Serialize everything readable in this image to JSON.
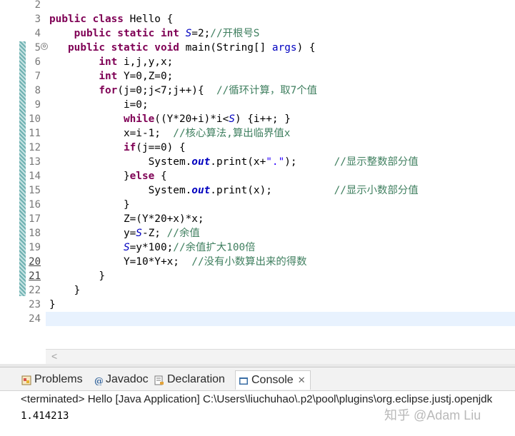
{
  "editor": {
    "line_numbers": [
      "2",
      "3",
      "4",
      "5",
      "6",
      "7",
      "8",
      "9",
      "10",
      "11",
      "12",
      "13",
      "14",
      "15",
      "16",
      "17",
      "18",
      "19",
      "20",
      "21",
      "22",
      "23",
      "24"
    ],
    "fold_symbol": "⊖",
    "code": {
      "l3": {
        "kw1": "public class ",
        "rest": "Hello {"
      },
      "l4": {
        "kw1": "public static int ",
        "sf": "S",
        "rest": "=2;",
        "cm": "//开根号S"
      },
      "l5": {
        "kw1": "public static void ",
        "rest": "main(String[] ",
        "vr": "args",
        ")": ") {"
      },
      "l6": {
        "kw1": "int ",
        "rest": "i,j,y,x;"
      },
      "l7": {
        "kw1": "int ",
        "rest": "Y=0,Z=0;"
      },
      "l8": {
        "kw1": "for",
        "rest": "(j=0;j<7;j++){  ",
        "cm": "//循环计算，取7个值"
      },
      "l9": {
        "rest": "i=0;"
      },
      "l10": {
        "kw1": "while",
        "rest1": "((Y*20+i)*i<",
        "sf": "S",
        "rest2": ") {i++; }"
      },
      "l11": {
        "rest": "x=i-1;  ",
        "cm": "//核心算法,算出临界值x"
      },
      "l12": {
        "kw1": "if",
        "rest": "(j==0) {"
      },
      "l13": {
        "rest1": "System.",
        "fd": "out",
        "rest2": ".print(x+",
        "st": "\".\"",
        "rest3": ");      ",
        "cm": "//显示整数部分值"
      },
      "l14": {
        "rest1": "}",
        "kw1": "else",
        "rest2": " {"
      },
      "l15": {
        "rest1": "System.",
        "fd": "out",
        "rest2": ".print(x);          ",
        "cm": "//显示小数部分值"
      },
      "l16": {
        "rest": "}"
      },
      "l17": {
        "rest": "Z=(Y*20+x)*x;"
      },
      "l18": {
        "rest1": "y=",
        "sf": "S",
        "rest2": "-Z; ",
        "cm": "//余值"
      },
      "l19": {
        "sf": "S",
        "rest": "=y*100;",
        "cm": "//余值扩大100倍"
      },
      "l20": {
        "rest": "Y=10*Y+x;  ",
        "cm": "//没有小数算出来的得数"
      },
      "l21": {
        "rest": "}"
      },
      "l22": {
        "rest": "}"
      },
      "l23": {
        "rest": "}"
      }
    },
    "scroll_left_arrow": "<"
  },
  "panel": {
    "tabs": [
      {
        "label": "Problems",
        "icon": "problems-icon"
      },
      {
        "label": "Javadoc",
        "icon": "javadoc-icon"
      },
      {
        "label": "Declaration",
        "icon": "declaration-icon"
      },
      {
        "label": "Console",
        "icon": "console-icon",
        "active": true
      }
    ],
    "close_symbol": "✕",
    "console_header": "<terminated> Hello [Java Application] C:\\Users\\liuchuhao\\.p2\\pool\\plugins\\org.eclipse.justj.openjdk",
    "console_output": "1.414213"
  },
  "watermark": "知乎 @Adam Liu",
  "colors": {
    "keyword": "#7f0055",
    "comment": "#3f7f5f",
    "string": "#2a00ff",
    "static_field": "#0000c0",
    "current_line": "#e8f2fe",
    "change_bar": "#6fb1b1"
  }
}
